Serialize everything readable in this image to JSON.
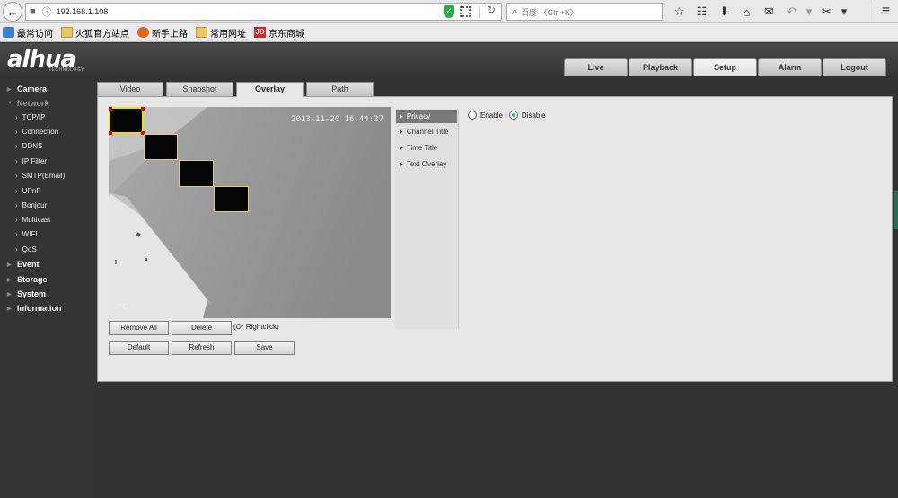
{
  "browser": {
    "url": "192.168.1.108",
    "search_placeholder": "百度 〈Ctrl+K〉",
    "bookmarks": [
      {
        "label": "最常访问",
        "icon": "ie-icon"
      },
      {
        "label": "火狐官方站点",
        "icon": "folder-icon"
      },
      {
        "label": "新手上路",
        "icon": "firefox-icon"
      },
      {
        "label": "常用网址",
        "icon": "folder-icon"
      },
      {
        "label": "京东商城",
        "icon": "jd-icon"
      }
    ]
  },
  "header": {
    "logo": "alhua",
    "logo_sub": "TECHNOLOGY",
    "tabs": [
      {
        "label": "Live",
        "active": false
      },
      {
        "label": "Playback",
        "active": false
      },
      {
        "label": "Setup",
        "active": true
      },
      {
        "label": "Alarm",
        "active": false
      },
      {
        "label": "Logout",
        "active": false
      }
    ]
  },
  "sidebar": {
    "camera": "Camera",
    "network": "Network",
    "network_items": [
      "TCP/IP",
      "Connection",
      "DDNS",
      "IP Filter",
      "SMTP(Email)",
      "UPnP",
      "Bonjour",
      "Multicast",
      "WIFI",
      "QoS"
    ],
    "event": "Event",
    "storage": "Storage",
    "system": "System",
    "information": "Information"
  },
  "sub_tabs": [
    {
      "label": "Video",
      "active": false
    },
    {
      "label": "Snapshot",
      "active": false
    },
    {
      "label": "Overlay",
      "active": true
    },
    {
      "label": "Path",
      "active": false
    }
  ],
  "preview": {
    "timestamp": "2013-11-20 16:44:37",
    "channel_label": "IPC"
  },
  "mask_buttons": {
    "remove_all": "Remove All",
    "delete": "Delete",
    "hint": "(Or Rightclick)"
  },
  "bottom_buttons": {
    "default": "Default",
    "refresh": "Refresh",
    "save": "Save"
  },
  "overlay_menu": [
    {
      "label": "Privacy",
      "active": true
    },
    {
      "label": "Channel Title",
      "active": false
    },
    {
      "label": "Time Title",
      "active": false
    },
    {
      "label": "Text Overlay",
      "active": false
    }
  ],
  "privacy": {
    "enable": "Enable",
    "disable": "Disable",
    "selected": "Disable"
  }
}
